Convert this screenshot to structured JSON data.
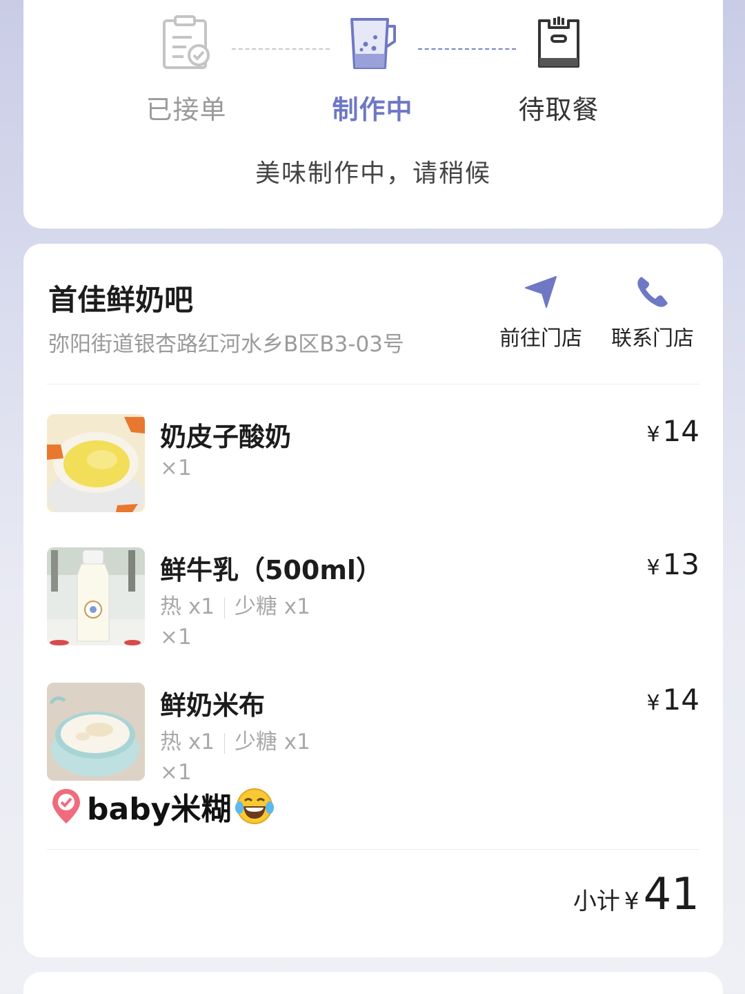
{
  "colors": {
    "accent": "#6f78c4",
    "card_background": "#ffffff",
    "page_background": "#d9dcee"
  },
  "progress": {
    "steps": [
      {
        "label": "已接单",
        "icon": "clipboard-check-icon",
        "state": "done"
      },
      {
        "label": "制作中",
        "icon": "blender-cup-icon",
        "state": "active"
      },
      {
        "label": "待取餐",
        "icon": "pickup-bag-icon",
        "state": "pending"
      }
    ],
    "message": "美味制作中，请稍候"
  },
  "store": {
    "name": "首佳鲜奶吧",
    "address": "弥阳街道银杏路红河水乡B区B3-03号",
    "actions": [
      {
        "label": "前往门店",
        "icon": "navigation-arrow-icon"
      },
      {
        "label": "联系门店",
        "icon": "phone-icon"
      }
    ]
  },
  "items": [
    {
      "name": "奶皮子酸奶",
      "specs": [],
      "qty": "×1",
      "currency": "¥",
      "price": "14",
      "thumbnail": "yogurt-photo"
    },
    {
      "name": "鲜牛乳（500ml）",
      "specs": [
        "热 x1",
        "少糖 x1"
      ],
      "qty": "×1",
      "currency": "¥",
      "price": "13",
      "thumbnail": "milk-bottle-photo"
    },
    {
      "name": "鲜奶米布",
      "specs": [
        "热 x1",
        "少糖 x1"
      ],
      "qty": "×1",
      "currency": "¥",
      "price": "14",
      "thumbnail": "milk-pudding-photo"
    }
  ],
  "overlay": {
    "caption": "baby米糊",
    "leading_icon": "location-pin-icon",
    "trailing_icon": "laughing-tears-emoji"
  },
  "summary": {
    "label": "小计",
    "currency": "¥",
    "amount": "41"
  }
}
